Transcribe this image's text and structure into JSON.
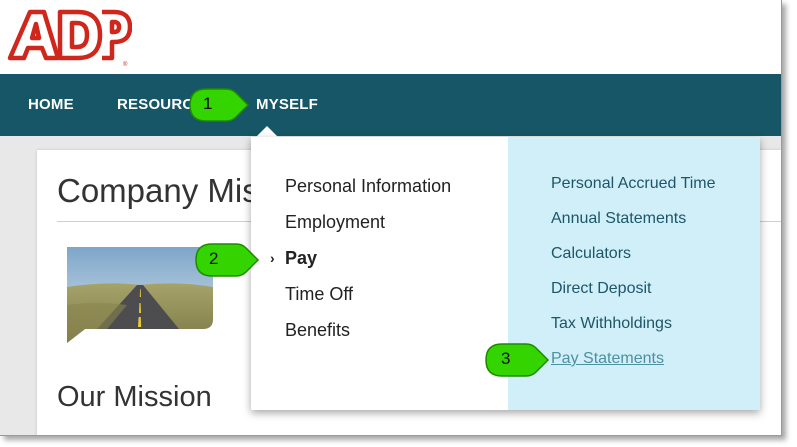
{
  "brand": {
    "logo_text": "ADP",
    "primary_color": "#d0271d",
    "nav_color": "#175666",
    "menu_right_bg": "#d0eff8",
    "callout_color": "#33d400"
  },
  "nav": {
    "home": "HOME",
    "resources": "RESOURCES",
    "myself": "MYSELF"
  },
  "content": {
    "title": "Company Mission",
    "section_title": "Our Mission"
  },
  "menu": {
    "left_items": [
      {
        "label": "Personal Information"
      },
      {
        "label": "Employment"
      },
      {
        "label": "Pay",
        "active": true
      },
      {
        "label": "Time Off"
      },
      {
        "label": "Benefits"
      }
    ],
    "right_items": [
      {
        "label": "Personal Accrued Time"
      },
      {
        "label": "Annual Statements"
      },
      {
        "label": "Calculators"
      },
      {
        "label": "Direct Deposit"
      },
      {
        "label": "Tax Withholdings"
      },
      {
        "label": "Pay Statements",
        "visited": true
      }
    ]
  },
  "callouts": [
    {
      "number": "1"
    },
    {
      "number": "2"
    },
    {
      "number": "3"
    }
  ]
}
